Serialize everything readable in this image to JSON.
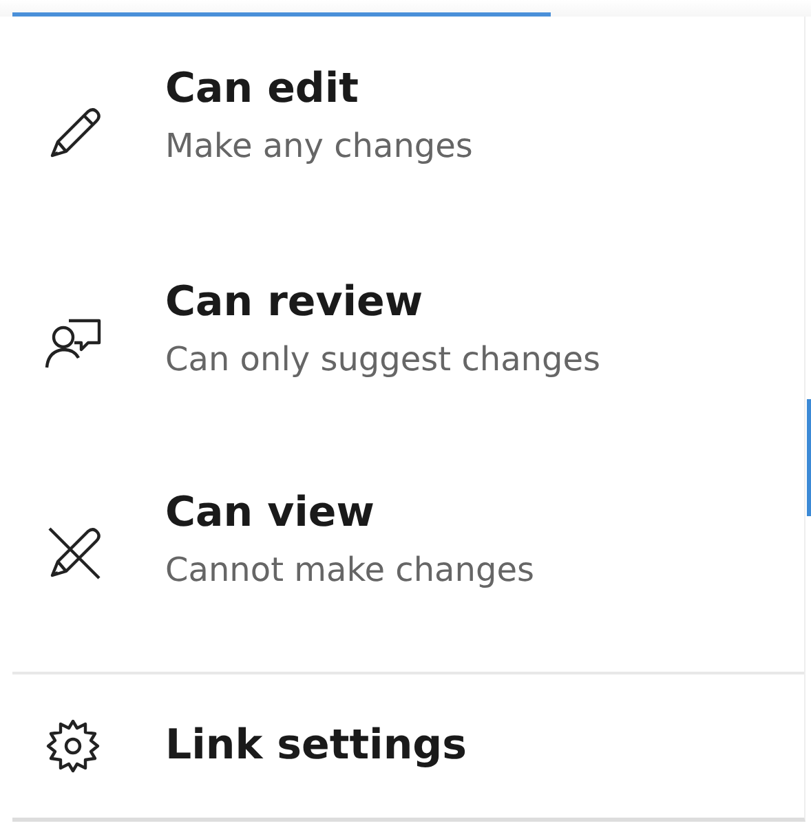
{
  "options": [
    {
      "kind": "edit",
      "title": "Can edit",
      "description": "Make any changes"
    },
    {
      "kind": "review",
      "title": "Can review",
      "description": "Can only suggest changes"
    },
    {
      "kind": "view",
      "title": "Can view",
      "description": "Cannot make changes"
    }
  ],
  "footer_action": {
    "kind": "settings",
    "label": "Link settings"
  }
}
